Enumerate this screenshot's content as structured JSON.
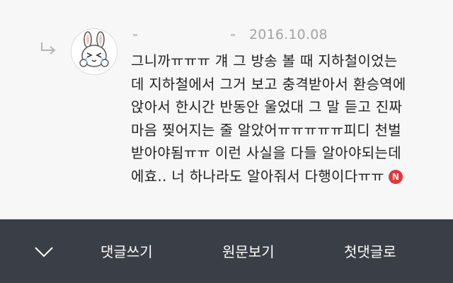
{
  "comment": {
    "date": "2016.10.08",
    "author": "",
    "lines": [
      "그니까ㅠㅠㅠ 걔 그 방송 볼 때 지하철이었는",
      "데 지하철에서 그거 보고 충격받아서 환승역에",
      "앉아서 한시간 반동안 울었대 그 말 듣고 진짜",
      "마음 찢어지는 줄 알았어ㅠㅠㅠㅠㅠ피디 천벌",
      "받아야됨ㅠㅠ 이런 사실을 다들 알아야되는데",
      "에효.. 너 하나라도 알아줘서 다행이다ㅠㅠ"
    ],
    "new_badge": "N",
    "avatar_icon": "bunny-avatar-icon",
    "reply_icon": "reply-arrow-icon"
  },
  "bottom_bar": {
    "collapse_icon": "chevron-down-icon",
    "write_comment": "댓글쓰기",
    "view_original": "원문보기",
    "first_comment": "첫댓글로"
  },
  "colors": {
    "background": "#f7f7f7",
    "bar": "#3a3e46",
    "badge": "#e8343a",
    "date": "#a3a3a3",
    "text": "#222222"
  }
}
